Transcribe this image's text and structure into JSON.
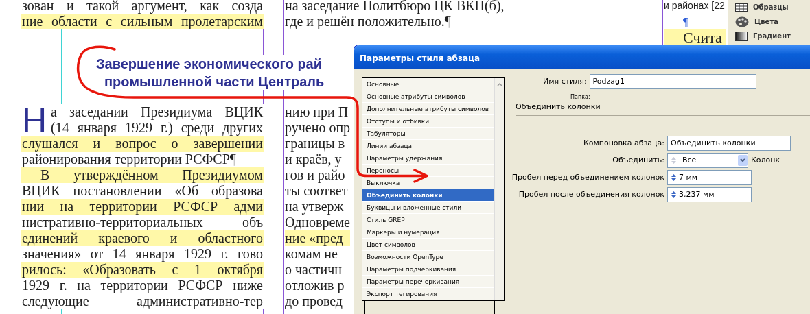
{
  "document": {
    "column_1_top": [
      {
        "text": "зован и такой аргумент, как созда",
        "highlighted": false
      },
      {
        "text": "ние области с сильным пролетарским",
        "highlighted": true
      }
    ],
    "column_2_top": [
      {
        "text": "на заседание Политбюро ЦК ВКП(б),",
        "highlighted": false
      },
      {
        "text": "где и решён положительно.¶",
        "highlighted": false
      }
    ],
    "heading": [
      "Завершение экономического рай",
      "промышленной части Централь"
    ],
    "drop_cap": "Н",
    "column_1_body": [
      {
        "text": "а заседании Президиума ВЦИК",
        "highlighted": false,
        "kind": "dropcap"
      },
      {
        "text": "(14 января 1929 г.) среди других",
        "highlighted": false,
        "kind": "dropcap"
      },
      {
        "text": "слушался и вопрос о завершении",
        "highlighted": true,
        "kind": "line"
      },
      {
        "text": "районирования территории РСФСР¶",
        "highlighted": false,
        "kind": "last"
      },
      {
        "text": "В утверждённом Президиумом",
        "highlighted": true,
        "kind": "first"
      },
      {
        "text": "ВЦИК постановлении «Об образова",
        "highlighted": false,
        "kind": "line"
      },
      {
        "text": "нии на территории РСФСР адми",
        "highlighted": true,
        "kind": "line"
      },
      {
        "text": "нистративно-территориальных объ",
        "highlighted": false,
        "kind": "line"
      },
      {
        "text": "единений краевого и областного",
        "highlighted": true,
        "kind": "line"
      },
      {
        "text": "значения» от 14 января 1929 г. гово",
        "highlighted": false,
        "kind": "line"
      },
      {
        "text": "рилось: «Образовать с 1 октября",
        "highlighted": true,
        "kind": "line"
      },
      {
        "text": "1929 г. на территории РСФСР ниже",
        "highlighted": false,
        "kind": "line"
      },
      {
        "text": "следующие административно-тер",
        "highlighted": false,
        "kind": "line"
      }
    ],
    "column_2_body": [
      {
        "text": "нию при П",
        "highlighted": false
      },
      {
        "text": "ручено опр",
        "highlighted": false
      },
      {
        "text": "границы в",
        "highlighted": false
      },
      {
        "text": "и краёв, у",
        "highlighted": false
      },
      {
        "text": "гов и райо",
        "highlighted": false
      },
      {
        "text": "ты соответ",
        "highlighted": false
      },
      {
        "text": "на утверж",
        "highlighted": false
      },
      {
        "text": "Одновреме",
        "highlighted": false
      },
      {
        "text": "ние «пред",
        "highlighted": true
      },
      {
        "text": "комам не",
        "highlighted": false
      },
      {
        "text": "о частичн",
        "highlighted": false
      },
      {
        "text": "отложив р",
        "highlighted": false
      },
      {
        "text": "до провед",
        "highlighted": false
      }
    ],
    "column_3": [
      {
        "text": "и районах [22",
        "highlighted": false,
        "kind": "small"
      },
      {
        "text": "¶",
        "highlighted": false,
        "kind": "mark"
      },
      {
        "text": "Счита",
        "highlighted": true,
        "kind": "first"
      }
    ]
  },
  "panel": {
    "items": [
      {
        "label": "Образцы",
        "kind": "swatches"
      },
      {
        "label": "Цвета",
        "kind": "palette"
      },
      {
        "label": "Градиент",
        "kind": "gradient"
      }
    ]
  },
  "dialog": {
    "title": "Параметры стиля абзаца",
    "categories": [
      {
        "label": "Основные",
        "selected": false
      },
      {
        "label": "Основные атрибуты символов",
        "selected": false
      },
      {
        "label": "Дополнительные атрибуты символов",
        "selected": false
      },
      {
        "label": "Отступы и отбивки",
        "selected": false
      },
      {
        "label": "Табуляторы",
        "selected": false
      },
      {
        "label": "Линии абзаца",
        "selected": false
      },
      {
        "label": "Параметры удержания",
        "selected": false
      },
      {
        "label": "Переносы",
        "selected": false
      },
      {
        "label": "Выключка",
        "selected": false
      },
      {
        "label": "Объединить колонки",
        "selected": true
      },
      {
        "label": "Буквицы и вложенные стили",
        "selected": false
      },
      {
        "label": "Стиль GREP",
        "selected": false
      },
      {
        "label": "Маркеры и нумерация",
        "selected": false
      },
      {
        "label": "Цвет символов",
        "selected": false
      },
      {
        "label": "Возможности OpenType",
        "selected": false
      },
      {
        "label": "Параметры подчеркивания",
        "selected": false
      },
      {
        "label": "Параметры перечеркивания",
        "selected": false
      },
      {
        "label": "Экспорт тегирования",
        "selected": false
      }
    ],
    "style_name_label": "Имя стиля:",
    "style_name": "Podzag1",
    "folder_label": "Папка:",
    "section_title": "Объединить колонки",
    "fields": [
      {
        "label": "Компоновка абзаца:",
        "value": "Объединить колонки",
        "kind": "text"
      },
      {
        "label": "Объединить:",
        "value": "Все",
        "kind": "combo",
        "disabled": true,
        "suffix": "Колонк"
      },
      {
        "label": "Пробел перед объединением колонок",
        "value": "7 мм",
        "kind": "spin",
        "disabled": false
      },
      {
        "label": "Пробел после объединения колонок",
        "value": "3,237 мм",
        "kind": "spin",
        "disabled": false
      }
    ]
  }
}
